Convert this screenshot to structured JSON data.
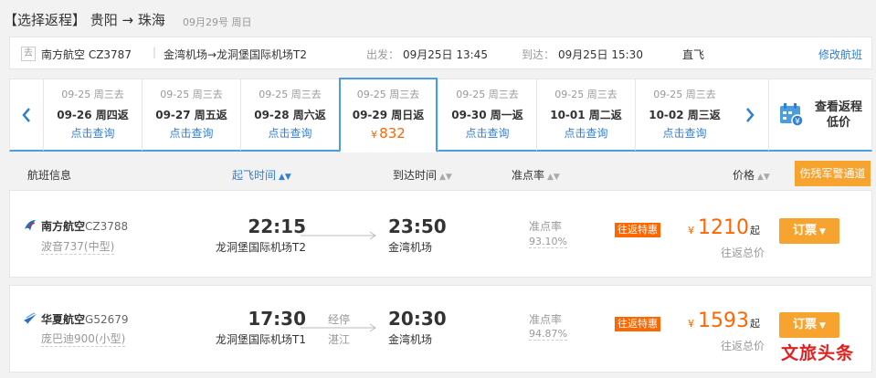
{
  "header": {
    "title": "【选择返程】 贵阳 → 珠海",
    "date": "09月29号 周日"
  },
  "outbound": {
    "tag": "去",
    "airline": "南方航空 CZ3787",
    "route": "金湾机场→龙洞堡国际机场T2",
    "dep_label": "出发：",
    "dep_time": "09月25日 13:45",
    "arr_label": "到达：",
    "arr_time": "09月25日 15:30",
    "type": "直飞",
    "modify": "修改航班"
  },
  "date_strip": {
    "cells": [
      {
        "go": "09-25 周三去",
        "ret": "09-26 周四返",
        "action": "点击查询"
      },
      {
        "go": "09-25 周三去",
        "ret": "09-27 周五返",
        "action": "点击查询"
      },
      {
        "go": "09-25 周三去",
        "ret": "09-28 周六返",
        "action": "点击查询"
      },
      {
        "go": "09-25 周三去",
        "ret": "09-29 周日返",
        "price": "832",
        "yen": "¥"
      },
      {
        "go": "09-25 周三去",
        "ret": "09-30 周一返",
        "action": "点击查询"
      },
      {
        "go": "09-25 周三去",
        "ret": "10-01 周二返",
        "action": "点击查询"
      },
      {
        "go": "09-25 周三去",
        "ret": "10-02 周三返",
        "action": "点击查询"
      }
    ],
    "view_return": "查看返程低价",
    "view_return_l1": "查看返程",
    "view_return_l2": "低价"
  },
  "columns": {
    "info": "航班信息",
    "dep": "起飞时间",
    "arr": "到达时间",
    "ontime": "准点率",
    "price": "价格",
    "military": "伤残军警通道"
  },
  "flights": [
    {
      "airline": "南方航空",
      "code": "CZ3788",
      "aircraft": "波音737(中型)",
      "dep_time": "22:15",
      "dep_airport": "龙洞堡国际机场T2",
      "stop_label": "",
      "stop_city": "",
      "arr_time": "23:50",
      "arr_airport": "金湾机场",
      "ontime_label": "准点率",
      "ontime_value": "93.10%",
      "badge": "往返特惠",
      "yen": "¥",
      "price": "1210",
      "qi": "起",
      "total": "往返总价",
      "book": "订票"
    },
    {
      "airline": "华夏航空",
      "code": "G52679",
      "aircraft": "庞巴迪900(小型)",
      "dep_time": "17:30",
      "dep_airport": "龙洞堡国际机场T1",
      "stop_label": "经停",
      "stop_city": "湛江",
      "arr_time": "20:30",
      "arr_airport": "金湾机场",
      "ontime_label": "准点率",
      "ontime_value": "94.87%",
      "badge": "往返特惠",
      "yen": "¥",
      "price": "1593",
      "qi": "起",
      "total": "往返总价",
      "book": "订票"
    }
  ],
  "watermark": "文旅头条",
  "colors": {
    "accent_blue": "#2f7fd4",
    "price_orange": "#ff6600",
    "button_orange": "#f7a330"
  }
}
